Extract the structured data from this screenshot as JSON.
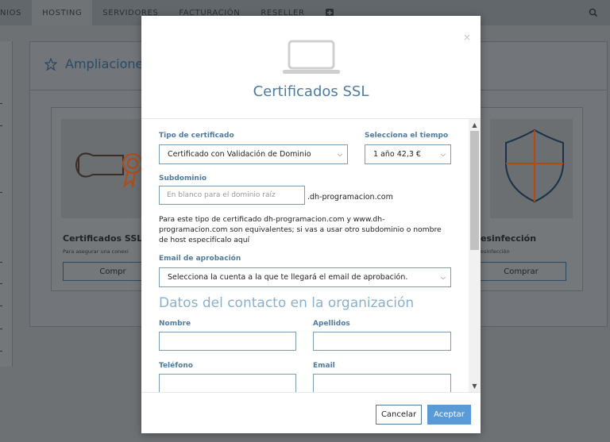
{
  "nav": {
    "items": [
      {
        "label": "NIOS",
        "active": false
      },
      {
        "label": "HOSTING",
        "active": true
      },
      {
        "label": "SERVIDORES",
        "active": false
      },
      {
        "label": "FACTURACIÓN",
        "active": false
      },
      {
        "label": "RESELLER",
        "active": false
      }
    ],
    "plus_icon": "plus-square-icon",
    "search_icon": "search-icon"
  },
  "background": {
    "panel_title": "Ampliaciones",
    "panel_icon": "star-outline-icon",
    "cards": [
      {
        "title": "Certificados SSL",
        "subtitle": "Para asegurar una conexi",
        "button": "Compr",
        "icon": "certificate-icon"
      },
      {
        "title": "esinfección",
        "subtitle": "esinfección",
        "button": "Comprar",
        "icon": "shield-icon"
      }
    ]
  },
  "modal": {
    "close": "×",
    "icon": "laptop-icon",
    "title": "Certificados SSL",
    "cert_type": {
      "label": "Tipo de certificado",
      "value": "Certificado con Validación de Dominio"
    },
    "time": {
      "label": "Selecciona el tiempo",
      "value": "1 año 42,3 €"
    },
    "subdomain": {
      "label": "Subdominio",
      "placeholder": "En blanco para el dominio raíz",
      "suffix": ".dh-programacion.com"
    },
    "info_text": "Para este tipo de certificado dh-programacion.com y www.dh-programacion.com son equivalentes; si vas a usar otro subdominio o nombre de host especifícalo aquí",
    "approval_email": {
      "label": "Email de aprobación",
      "value": "Selecciona la cuenta a la que te llegará el email de aprobación."
    },
    "contact_section": "Datos del contacto en la organización",
    "fields": {
      "nombre": "Nombre",
      "apellidos": "Apellidos",
      "telefono": "Teléfono",
      "email": "Email"
    },
    "buttons": {
      "cancel": "Cancelar",
      "accept": "Aceptar"
    }
  },
  "colors": {
    "accent": "#4f7ba1",
    "primary_button": "#5a9ad6",
    "section_title": "#8ab0cf"
  }
}
